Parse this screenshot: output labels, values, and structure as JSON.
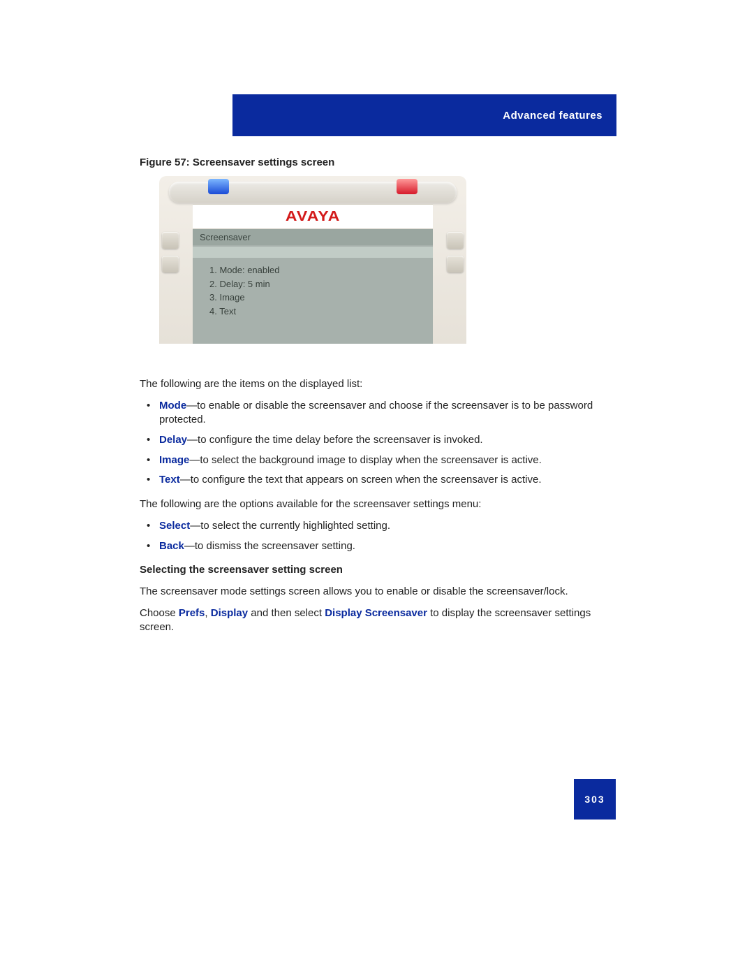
{
  "header": {
    "section_title": "Advanced features"
  },
  "figure": {
    "caption": "Figure 57: Screensaver settings screen",
    "brand": "AVAYA",
    "screen_title": "Screensaver",
    "menu_items": [
      "1. Mode: enabled",
      "2. Delay: 5 min",
      "3. Image",
      "4. Text"
    ]
  },
  "body": {
    "intro1": "The following are the items on the displayed list:",
    "items": [
      {
        "kw": "Mode",
        "desc": "—to enable or disable the screensaver and choose if the screensaver is to be password protected."
      },
      {
        "kw": "Delay",
        "desc": "—to configure the time delay before the screensaver is invoked."
      },
      {
        "kw": "Image",
        "desc": "—to select the background image to display when the screensaver is active."
      },
      {
        "kw": "Text",
        "desc": "—to configure the text that appears on screen when the screensaver is active."
      }
    ],
    "intro2": "The following are the options available for the screensaver settings menu:",
    "options": [
      {
        "kw": "Select",
        "desc": "—to select the currently highlighted setting."
      },
      {
        "kw": "Back",
        "desc": "—to dismiss the screensaver setting."
      }
    ],
    "subhead": "Selecting the screensaver setting screen",
    "para1": "The screensaver mode settings screen allows you to enable or disable the screensaver/lock.",
    "para2_pre": "Choose ",
    "para2_kw1": "Prefs",
    "para2_sep1": ", ",
    "para2_kw2": "Display",
    "para2_mid": " and then select ",
    "para2_kw3": "Display Screensaver",
    "para2_post": " to display the screensaver settings screen."
  },
  "page_number": "303"
}
